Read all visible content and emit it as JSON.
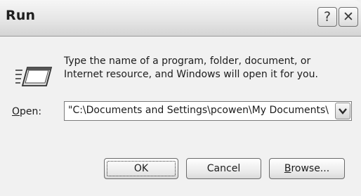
{
  "window": {
    "title": "Run"
  },
  "title_buttons": {
    "help_glyph": "?",
    "close_glyph": "✕"
  },
  "description": "Type the name of a program, folder, document, or Internet resource, and Windows will open it for you.",
  "open_field": {
    "label_underlined": "O",
    "label_rest": "pen:",
    "value": "\"C:\\Documents and Settings\\pcowen\\My Documents\\"
  },
  "buttons": {
    "ok": "OK",
    "cancel": "Cancel",
    "browse_underlined": "B",
    "browse_rest": "rowse..."
  },
  "icons": {
    "run": "run-window-icon",
    "help": "help-icon",
    "close": "close-icon",
    "dropdown": "chevron-down-icon"
  }
}
